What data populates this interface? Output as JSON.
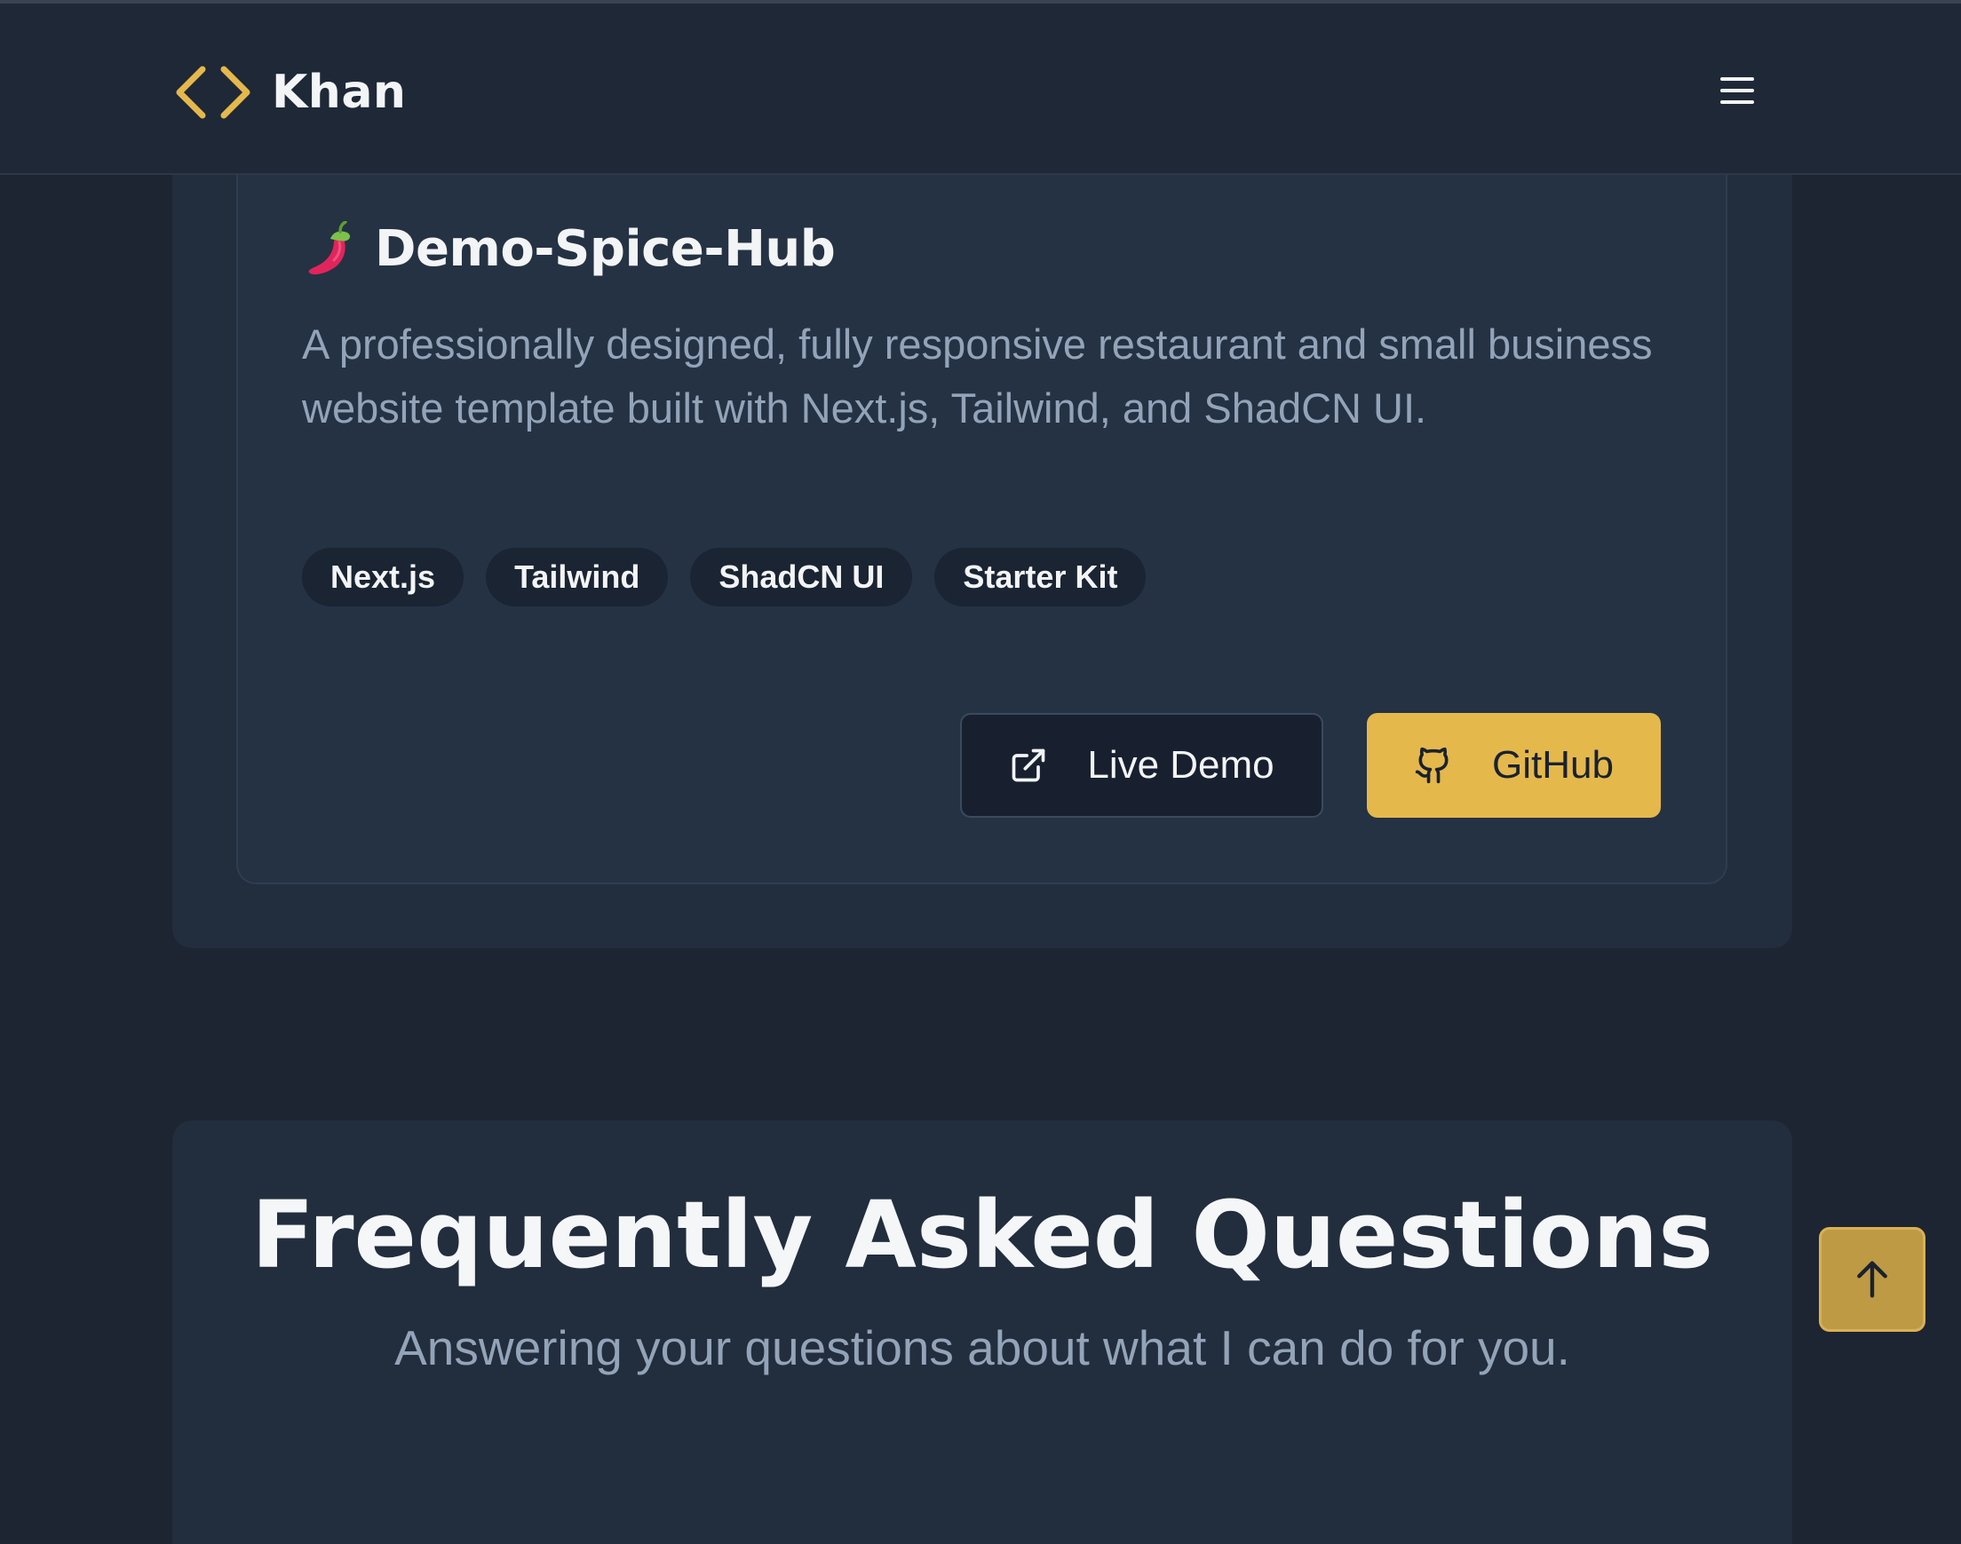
{
  "header": {
    "brand_name": "Khan",
    "brand_icon": "code-brackets-icon",
    "menu_icon": "hamburger-menu-icon",
    "accent_color": "#e5b84c"
  },
  "project": {
    "emoji": "🌶️",
    "title": "Demo-Spice-Hub",
    "description": "A professionally designed, fully responsive restaurant and small business website template built with Next.js, Tailwind, and ShadCN UI.",
    "tags": [
      "Next.js",
      "Tailwind",
      "ShadCN UI",
      "Starter Kit"
    ],
    "live_demo_label": "Live Demo",
    "live_demo_icon": "external-link-icon",
    "github_label": "GitHub",
    "github_icon": "github-icon"
  },
  "faq": {
    "title": "Frequently Asked Questions",
    "subtitle": "Answering your questions about what I can do for you."
  },
  "scroll_top": {
    "icon": "arrow-up-icon"
  }
}
